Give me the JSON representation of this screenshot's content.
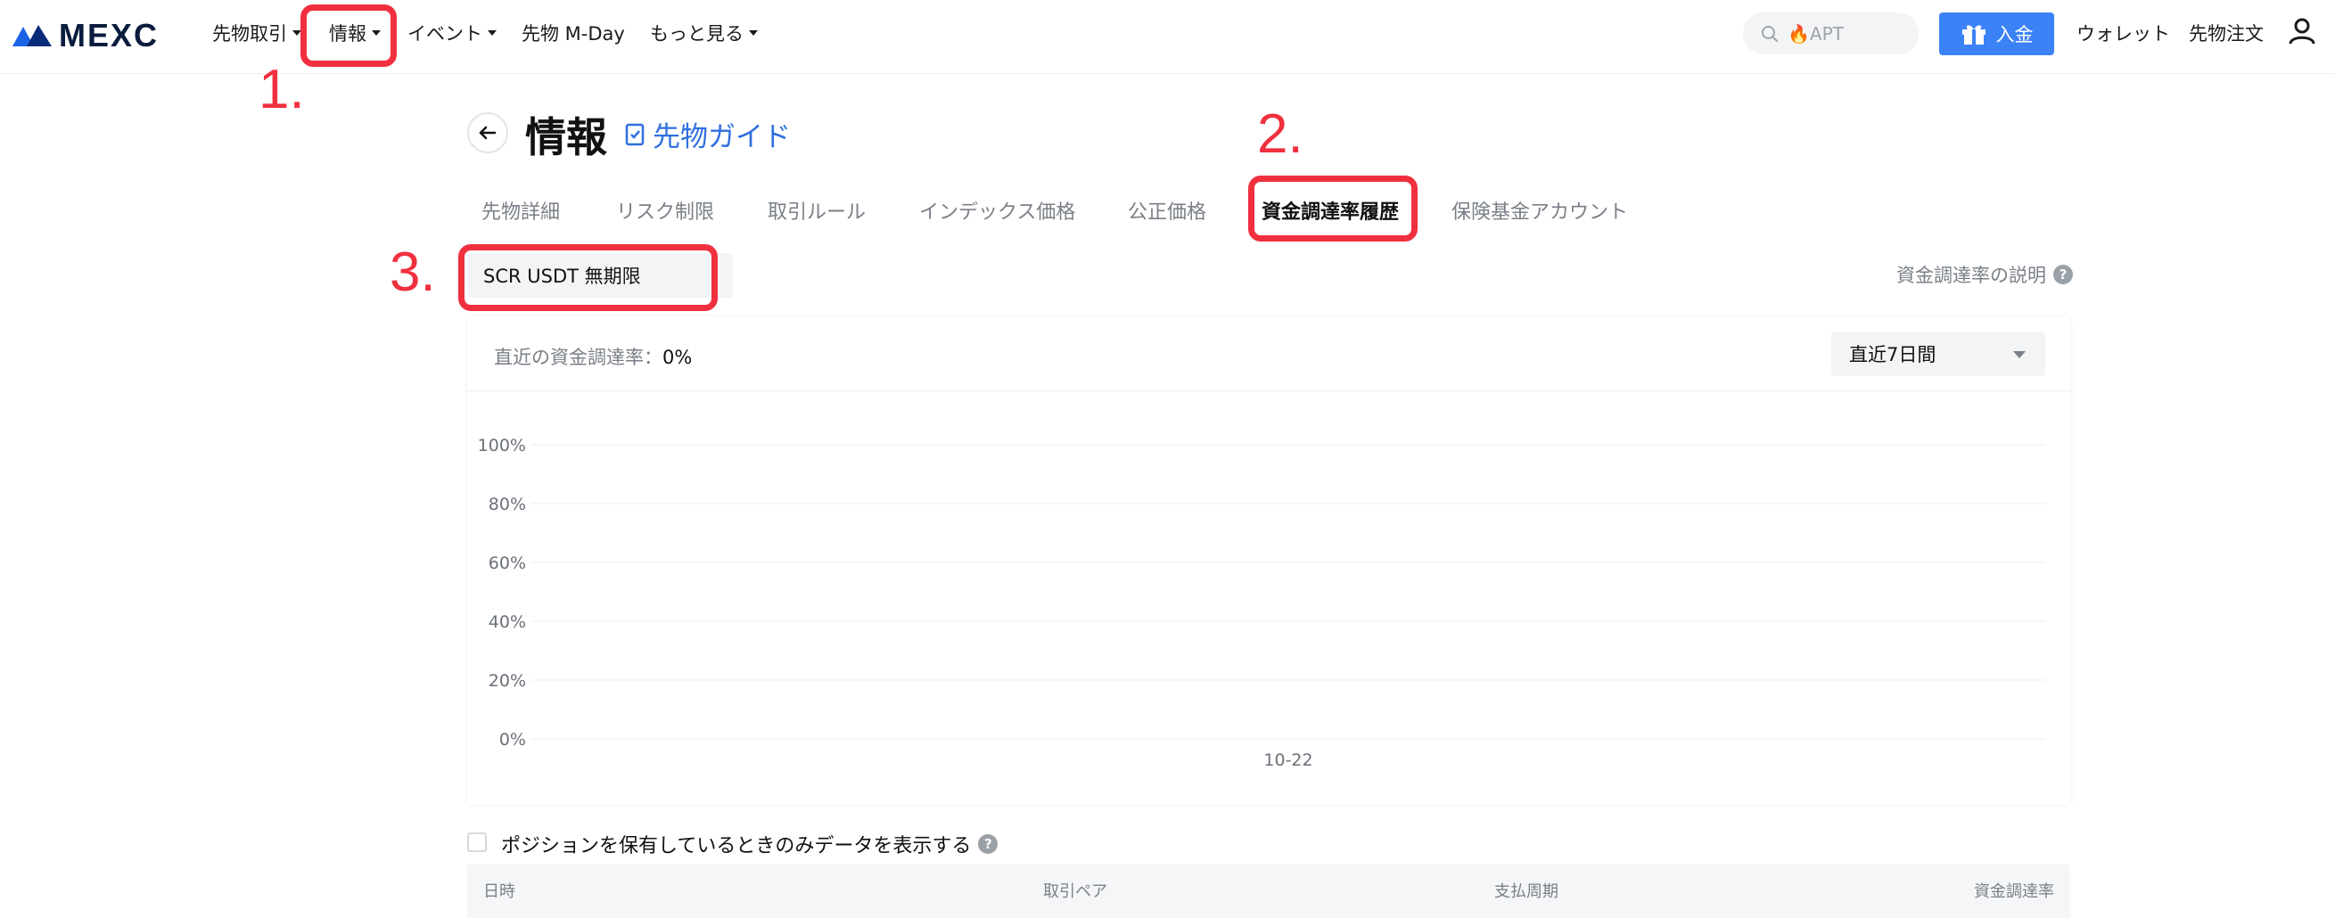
{
  "brand": {
    "logo_text": "MEXC",
    "accent": "#3b82f6",
    "highlight": "#f0303e"
  },
  "nav": {
    "items": [
      {
        "label": "先物取引",
        "dropdown": true
      },
      {
        "label": "情報",
        "dropdown": true
      },
      {
        "label": "イベント",
        "dropdown": true
      },
      {
        "label": "先物 M-Day",
        "dropdown": false
      },
      {
        "label": "もっと見る",
        "dropdown": true
      }
    ],
    "search_placeholder": "🔥APT",
    "deposit_label": "入金",
    "wallet_label": "ウォレット",
    "orders_label": "先物注文"
  },
  "annotations": {
    "step1": "1.",
    "step2": "2.",
    "step3": "3."
  },
  "page": {
    "title": "情報",
    "guide_link": "先物ガイド"
  },
  "tabs": [
    {
      "label": "先物詳細"
    },
    {
      "label": "リスク制限"
    },
    {
      "label": "取引ルール"
    },
    {
      "label": "インデックス価格"
    },
    {
      "label": "公正価格"
    },
    {
      "label": "資金調達率履歴",
      "active": true
    },
    {
      "label": "保険基金アカウント"
    }
  ],
  "selector": {
    "contract": "SCR USDT 無期限",
    "explain_link": "資金調達率の説明"
  },
  "card": {
    "last_rate_label": "直近の資金調達率：",
    "last_rate_value": "0%",
    "range_value": "直近7日間"
  },
  "chart_data": {
    "type": "line",
    "x": [
      "10-22"
    ],
    "yticks": [
      "100%",
      "80%",
      "60%",
      "40%",
      "20%",
      "0%"
    ],
    "ylim": [
      0,
      100
    ],
    "series": [
      {
        "values": [
          0
        ]
      }
    ],
    "grid": true
  },
  "filter": {
    "only_positions_label": "ポジションを保有しているときのみデータを表示する"
  },
  "table": {
    "columns": [
      "日時",
      "取引ペア",
      "支払周期",
      "資金調達率"
    ]
  }
}
